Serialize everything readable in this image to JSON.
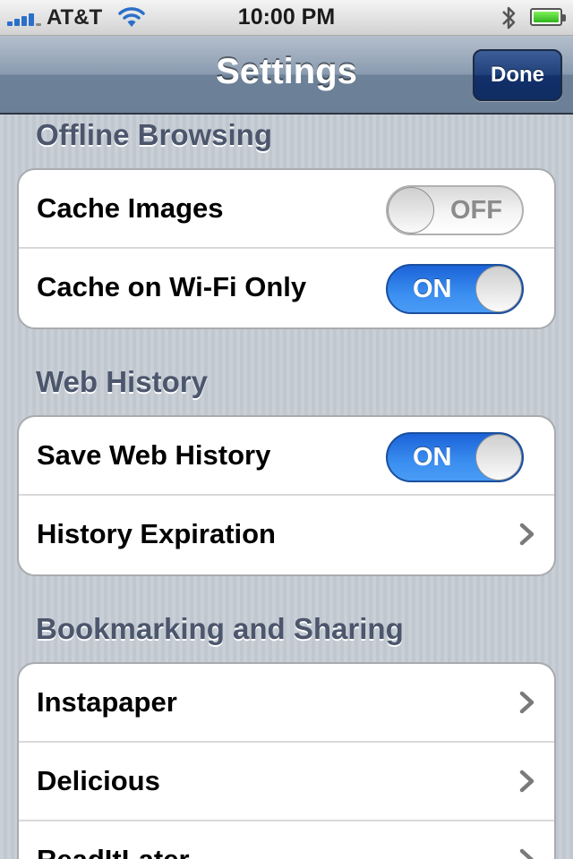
{
  "status_bar": {
    "carrier": "AT&T",
    "time": "10:00 PM",
    "icons": [
      "signal-icon",
      "wifi-icon",
      "bluetooth-icon",
      "battery-icon"
    ]
  },
  "nav": {
    "title": "Settings",
    "done_label": "Done"
  },
  "sections": [
    {
      "header": "Offline Browsing",
      "rows": [
        {
          "label": "Cache Images",
          "type": "switch",
          "state": "OFF"
        },
        {
          "label": "Cache on Wi-Fi Only",
          "type": "switch",
          "state": "ON"
        }
      ]
    },
    {
      "header": "Web History",
      "rows": [
        {
          "label": "Save Web History",
          "type": "switch",
          "state": "ON"
        },
        {
          "label": "History Expiration",
          "type": "disclosure"
        }
      ]
    },
    {
      "header": "Bookmarking and Sharing",
      "rows": [
        {
          "label": "Instapaper",
          "type": "disclosure"
        },
        {
          "label": "Delicious",
          "type": "disclosure"
        },
        {
          "label": "ReadItLater",
          "type": "disclosure"
        }
      ]
    }
  ],
  "colors": {
    "background": "#c5ccd4",
    "switch_on": "#2f7fe8",
    "section_header": "#4c566c",
    "done_button": "#20407a"
  }
}
